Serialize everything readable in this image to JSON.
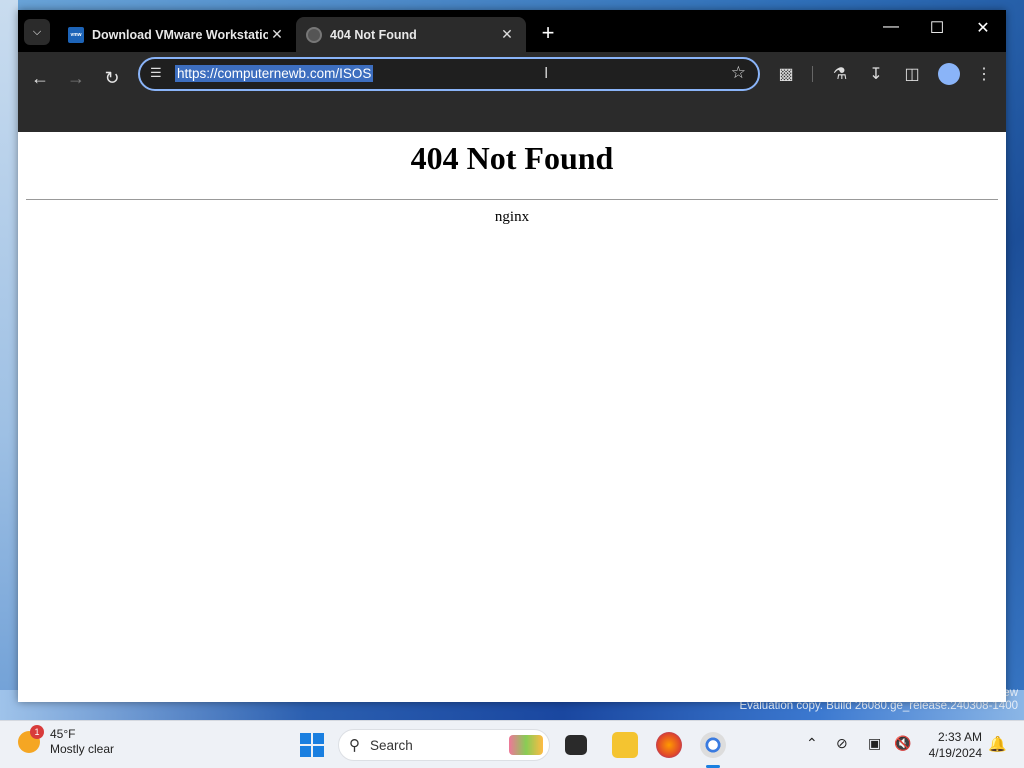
{
  "browser": {
    "tabs": [
      {
        "title": "Download VMware Workstatio",
        "favicon": "vmware-logo-icon",
        "favicon_text": "vmw",
        "active": false
      },
      {
        "title": "404 Not Found",
        "favicon": "globe-icon",
        "active": true
      }
    ],
    "new_tab": "+",
    "address": {
      "url": "https://computernewb.com/ISOS"
    }
  },
  "page": {
    "heading": "404 Not Found",
    "server": "nginx"
  },
  "desktop": {
    "watermark_line1": "Evaluation copy. Build 26080.ge_release.240308-1400",
    "watermark_fragment": "ew"
  },
  "taskbar": {
    "weather": {
      "temp": "45°F",
      "condition": "Mostly clear",
      "badge": "1"
    },
    "search_placeholder": "Search",
    "clock": {
      "time": "2:33 AM",
      "date": "4/19/2024"
    }
  }
}
